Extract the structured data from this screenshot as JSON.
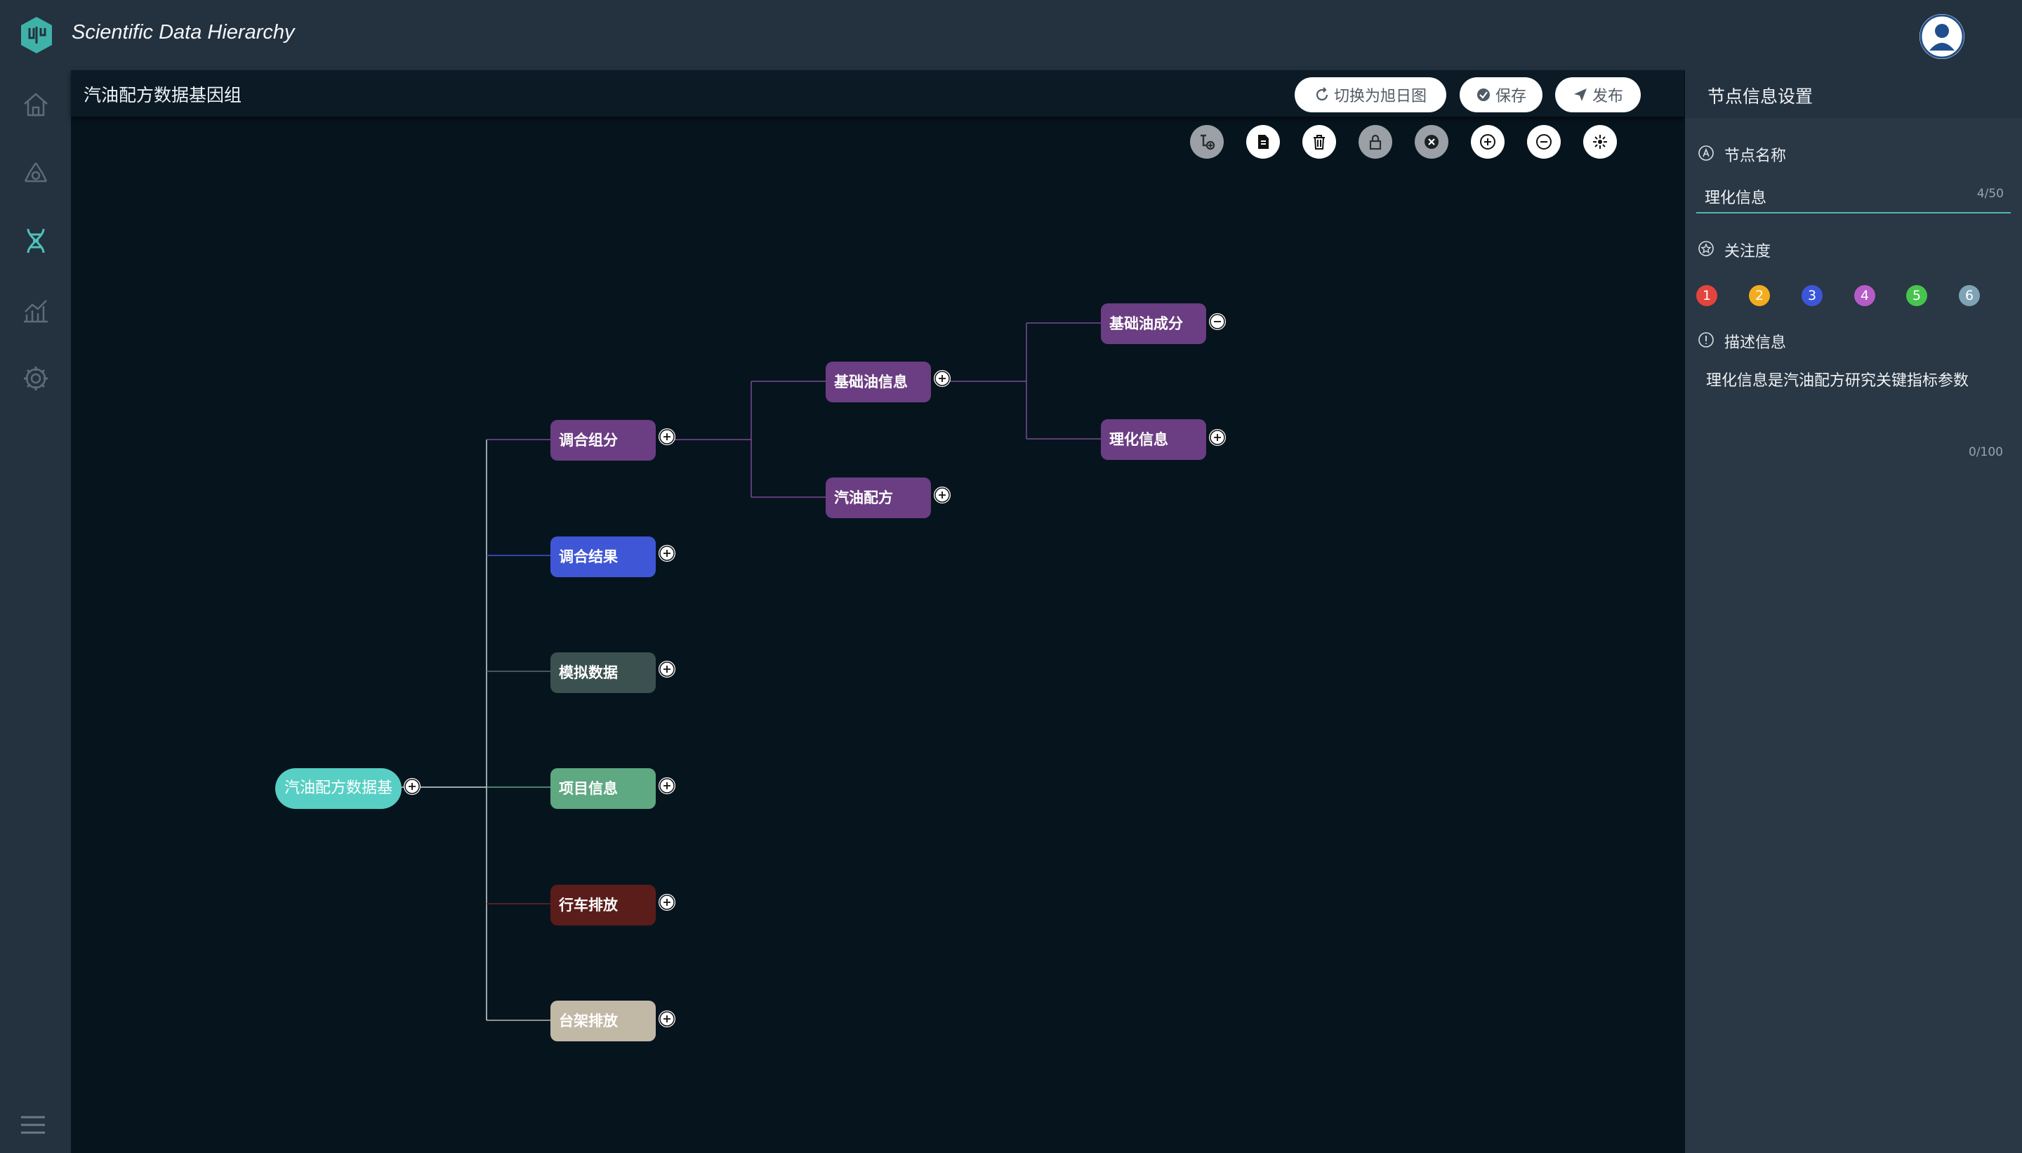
{
  "app": {
    "title": "Scientific Data Hierarchy"
  },
  "sidebar": {
    "items": [
      {
        "icon": "home-icon"
      },
      {
        "icon": "recycle-icon"
      },
      {
        "icon": "dna-icon"
      },
      {
        "icon": "chart-icon"
      },
      {
        "icon": "gear-icon"
      }
    ]
  },
  "workspace": {
    "title": "汽油配方数据基因组",
    "buttons": {
      "switch": "切换为旭日图",
      "save": "保存",
      "publish": "发布"
    },
    "toolbar": [
      "add-child-icon",
      "document-icon",
      "trash-icon",
      "lock-icon",
      "close-icon",
      "zoom-in-icon",
      "zoom-out-icon",
      "fit-icon"
    ]
  },
  "map": {
    "root": {
      "label": "汽油配方数据基",
      "color": "#58cfc4"
    },
    "level1": [
      {
        "label": "调合组分",
        "color": "#6b3d82"
      },
      {
        "label": "调合结果",
        "color": "#3f56d6"
      },
      {
        "label": "模拟数据",
        "color": "#3b5150"
      },
      {
        "label": "项目信息",
        "color": "#5ea882"
      },
      {
        "label": "行车排放",
        "color": "#5a1d1a"
      },
      {
        "label": "台架排放",
        "color": "#c2b8a6"
      }
    ],
    "level2": [
      {
        "label": "基础油信息",
        "color": "#6b3d82"
      },
      {
        "label": "汽油配方",
        "color": "#6b3d82"
      }
    ],
    "level3": [
      {
        "label": "基础油成分",
        "color": "#6b3d82"
      },
      {
        "label": "理化信息",
        "color": "#6b3d82"
      }
    ]
  },
  "panel": {
    "title": "节点信息设置",
    "name_label": "节点名称",
    "name_value": "理化信息",
    "name_count": "4/50",
    "attention_label": "关注度",
    "ratings": [
      {
        "value": "1",
        "color": "#e2453e"
      },
      {
        "value": "2",
        "color": "#f2ad1f"
      },
      {
        "value": "3",
        "color": "#3c56d8"
      },
      {
        "value": "4",
        "color": "#b65cc8"
      },
      {
        "value": "5",
        "color": "#47c44f"
      },
      {
        "value": "6",
        "color": "#7fa3b4"
      }
    ],
    "desc_label": "描述信息",
    "desc_value": "理化信息是汽油配方研究关键指标参数",
    "desc_count": "0/100"
  }
}
